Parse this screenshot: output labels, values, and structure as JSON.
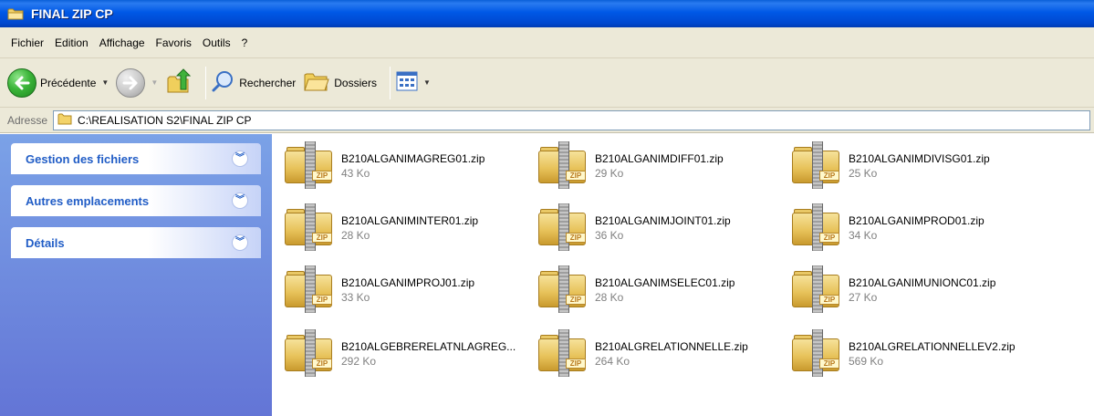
{
  "window": {
    "title": "FINAL ZIP CP"
  },
  "menu": [
    "Fichier",
    "Edition",
    "Affichage",
    "Favoris",
    "Outils",
    "?"
  ],
  "toolbar": {
    "back_label": "Précédente",
    "search_label": "Rechercher",
    "folders_label": "Dossiers"
  },
  "address": {
    "label": "Adresse",
    "path": "C:\\REALISATION S2\\FINAL ZIP CP"
  },
  "taskpane": {
    "sections": [
      "Gestion des fichiers",
      "Autres emplacements",
      "Détails"
    ]
  },
  "files": [
    {
      "name": "B210ALGANIMAGREG01.zip",
      "size": "43 Ko"
    },
    {
      "name": "B210ALGANIMDIFF01.zip",
      "size": "29 Ko"
    },
    {
      "name": "B210ALGANIMDIVISG01.zip",
      "size": "25 Ko"
    },
    {
      "name": "B210ALGANIMINTER01.zip",
      "size": "28 Ko"
    },
    {
      "name": "B210ALGANIMJOINT01.zip",
      "size": "36 Ko"
    },
    {
      "name": "B210ALGANIMPROD01.zip",
      "size": "34 Ko"
    },
    {
      "name": "B210ALGANIMPROJ01.zip",
      "size": "33 Ko"
    },
    {
      "name": "B210ALGANIMSELEC01.zip",
      "size": "28 Ko"
    },
    {
      "name": "B210ALGANIMUNIONC01.zip",
      "size": "27 Ko"
    },
    {
      "name": "B210ALGEBRERELATNLAGREG...",
      "size": "292 Ko"
    },
    {
      "name": "B210ALGRELATIONNELLE.zip",
      "size": "264 Ko"
    },
    {
      "name": "B210ALGRELATIONNELLEV2.zip",
      "size": "569 Ko"
    }
  ],
  "zip_badge": "ZIP",
  "colors": {
    "titlebar": "#0058e6",
    "chrome": "#ece9d8",
    "taskpane_top": "#7ba2e7",
    "taskpane_bottom": "#6375d6",
    "task_title": "#215dc6"
  }
}
